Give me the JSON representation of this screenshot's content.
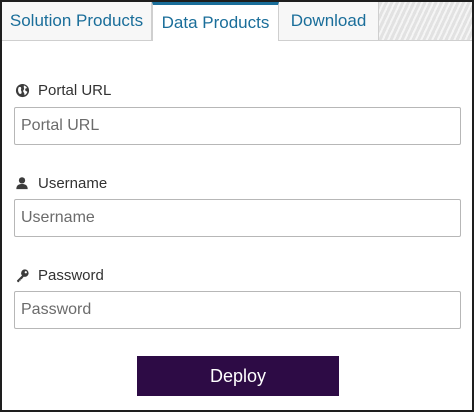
{
  "tabs": [
    {
      "label": "Solution Products",
      "active": false
    },
    {
      "label": "Data Products",
      "active": true
    },
    {
      "label": "Download",
      "active": false
    }
  ],
  "form": {
    "portal_url": {
      "label": "Portal URL",
      "placeholder": "Portal URL",
      "value": "",
      "icon": "globe-icon"
    },
    "username": {
      "label": "Username",
      "placeholder": "Username",
      "value": "",
      "icon": "user-icon"
    },
    "password": {
      "label": "Password",
      "placeholder": "Password",
      "value": "",
      "icon": "key-icon"
    }
  },
  "actions": {
    "deploy_label": "Deploy"
  },
  "colors": {
    "accent": "#1a6e9a",
    "deploy_bg": "#2d0b45"
  }
}
